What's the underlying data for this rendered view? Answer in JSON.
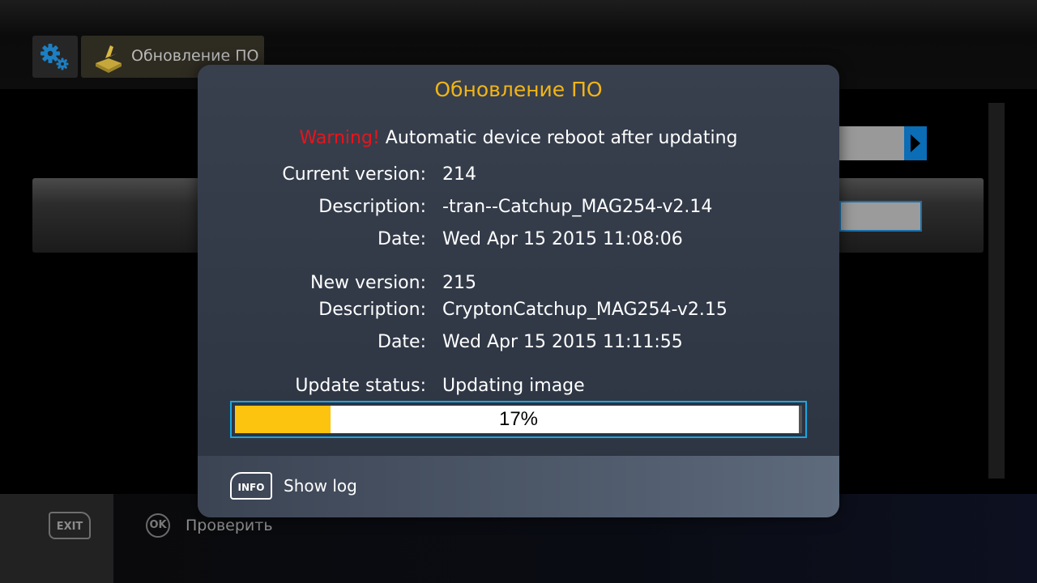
{
  "header": {
    "section_title": "Обновление ПО"
  },
  "dialog": {
    "title": "Обновление ПО",
    "warning_label": "Warning!",
    "warning_text": " Automatic device reboot after updating",
    "current": {
      "version_label": "Current version:",
      "version": "214",
      "description_label": "Description:",
      "description": "-tran--Catchup_MAG254-v2.14",
      "date_label": "Date:",
      "date": "Wed Apr 15 2015 11:08:06"
    },
    "new": {
      "version_label": "New version:",
      "version": "215",
      "description_label": "Description:",
      "description": "CryptonCatchup_MAG254-v2.15",
      "date_label": "Date:",
      "date": "Wed Apr 15 2015 11:11:55"
    },
    "status_label": "Update status:",
    "status": "Updating image",
    "progress_percent": 17,
    "progress_text": "17%",
    "footer": {
      "info_key": "INFO",
      "show_log": "Show log"
    }
  },
  "bottom_bar": {
    "exit_key": "EXIT",
    "ok_key": "OK",
    "ok_label": "Проверить"
  },
  "colors": {
    "accent_title": "#f2b516",
    "warning": "#e8141b",
    "progress_fill": "#fcc30f",
    "progress_border": "#19a7e2"
  },
  "icons": [
    "gear-icon",
    "update-icon",
    "info-key-icon",
    "exit-key-icon",
    "ok-key-icon",
    "arrow-right-icon"
  ]
}
